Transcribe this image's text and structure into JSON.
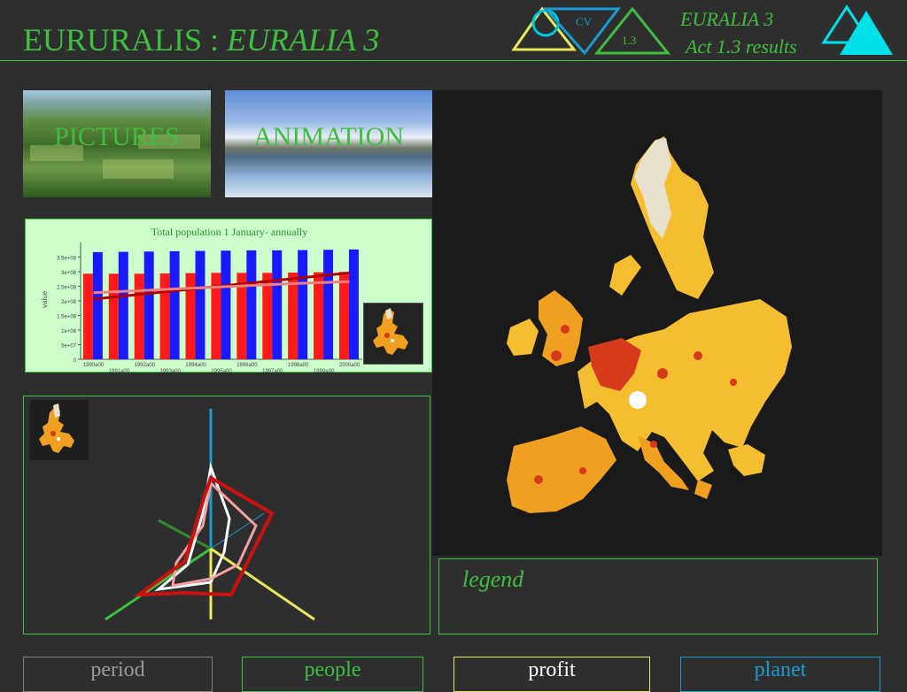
{
  "header": {
    "title_main": "EURURALIS : ",
    "title_sub": "EURALIA 3",
    "logo_labels": {
      "cv": "CV",
      "version": "1.3"
    },
    "crumb_line1": "EURALIA 3",
    "crumb_line2": "Act 1.3 results"
  },
  "tiles": {
    "pictures": "PICTURES",
    "animation": "ANIMATION"
  },
  "chart_data": {
    "type": "bar",
    "title": "Total population 1 January- annually",
    "xlabel": "",
    "ylabel": "value",
    "ylim": [
      0,
      400000000
    ],
    "y_ticks": [
      "0",
      "5e+07",
      "1e+08",
      "1.5e+08",
      "2e+08",
      "2.5e+08",
      "3e+08",
      "3.5e+08"
    ],
    "categories": [
      "1990a00",
      "1991a00",
      "1992a00",
      "1993a00",
      "1994a00",
      "1995a00",
      "1996a00",
      "1997a00",
      "1998a00",
      "1999a00",
      "2000a00"
    ],
    "series": [
      {
        "color": "#ff1a1a",
        "values": [
          293000000,
          293000000,
          293000000,
          294000000,
          295000000,
          296000000,
          296000000,
          296000000,
          297000000,
          298000000,
          299000000
        ]
      },
      {
        "color": "#1a1aff",
        "values": [
          367000000,
          368000000,
          369000000,
          370000000,
          371000000,
          372000000,
          373000000,
          373000000,
          374000000,
          375000000,
          376000000
        ]
      }
    ],
    "trend_lines": [
      {
        "color": "#b00000",
        "values": [
          206000000,
          215000000,
          224000000,
          233000000,
          242000000,
          251000000,
          260000000,
          269000000,
          278000000,
          287000000,
          296000000
        ]
      },
      {
        "color": "#f08080",
        "values": [
          228000000,
          232000000,
          236000000,
          240000000,
          244000000,
          248000000,
          252000000,
          256000000,
          260000000,
          263000000,
          266000000
        ]
      }
    ],
    "legend": "none",
    "grid": false
  },
  "legend_panel": {
    "label": "legend"
  },
  "tabs": {
    "period": "period",
    "people": "people",
    "profit": "profit",
    "planet": "planet"
  },
  "colors": {
    "background": "#2e2e2e",
    "accent_green": "#3fbf3f",
    "accent_cyan": "#1a9bd1",
    "accent_yellow": "#e8e85a",
    "map_base": "#f2b22e",
    "map_high": "#d63a1a"
  }
}
